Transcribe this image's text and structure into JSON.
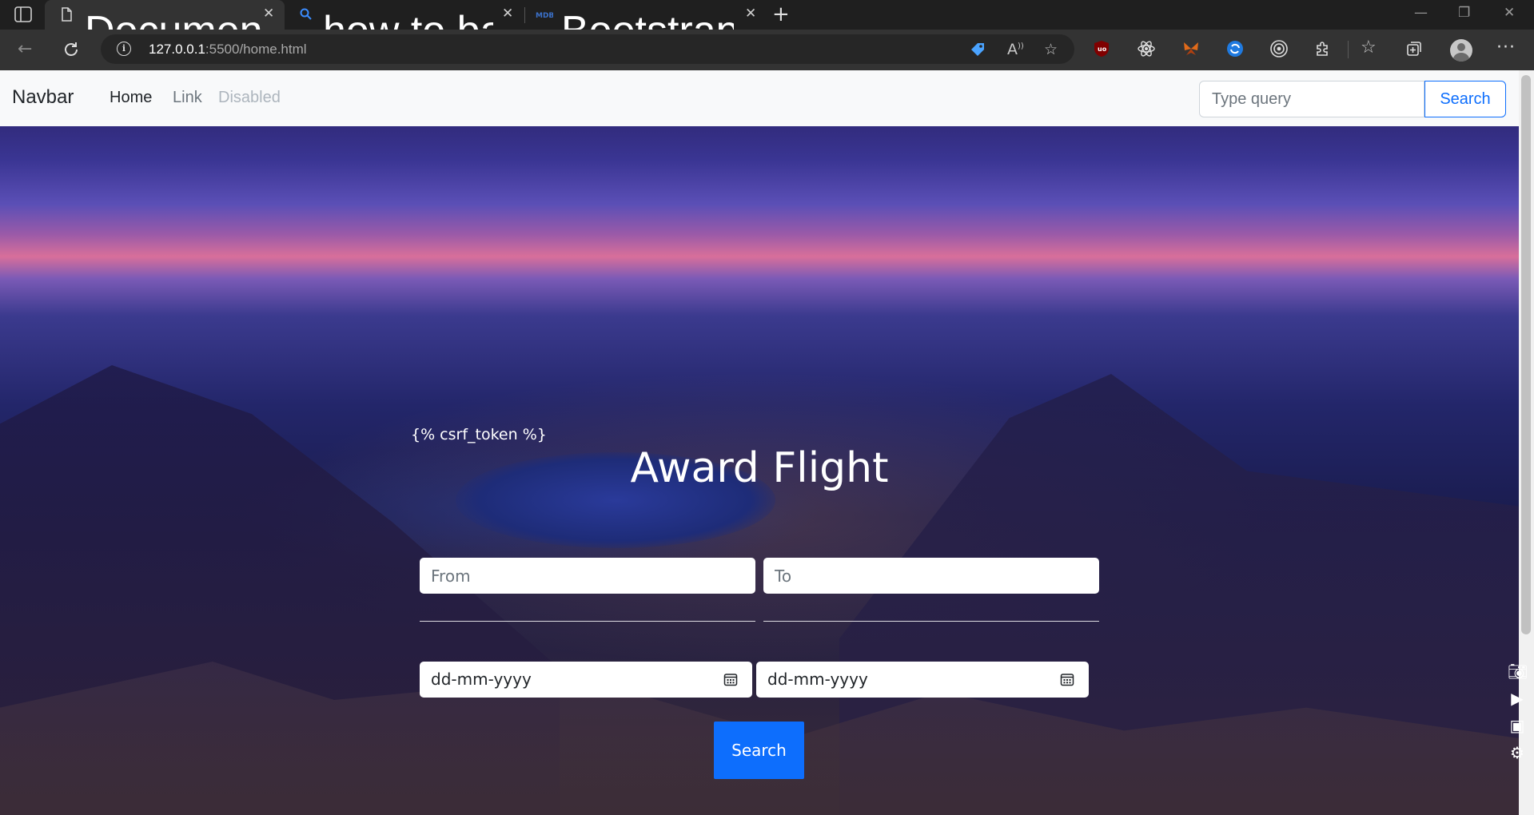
{
  "browser": {
    "tabs": [
      {
        "title": "Document",
        "active": true
      },
      {
        "title": "how to background image in boo",
        "active": false
      },
      {
        "title": "Bootstrap Navbar - examples & t",
        "active": false
      }
    ],
    "url_host": "127.0.0.1",
    "url_path": ":5500/home.html",
    "extensions": [
      "ublock-icon",
      "react-icon",
      "butterfly-icon",
      "blue-circle-icon",
      "target-icon",
      "puzzle-icon"
    ]
  },
  "navbar": {
    "brand": "Navbar",
    "links": [
      "Home",
      "Link",
      "Disabled"
    ],
    "search_placeholder": "Type query",
    "search_button": "Search"
  },
  "form": {
    "csrf_text": "{% csrf_token %}",
    "title": "Award Flight",
    "from_placeholder": "From",
    "to_placeholder": "To",
    "date_1": "dd-mm-yyyy",
    "date_2": "dd-mm-yyyy",
    "submit": "Search"
  },
  "colors": {
    "primary": "#0d6efd",
    "navbar_bg": "#f8f9fa",
    "chrome_bg": "#333333"
  }
}
